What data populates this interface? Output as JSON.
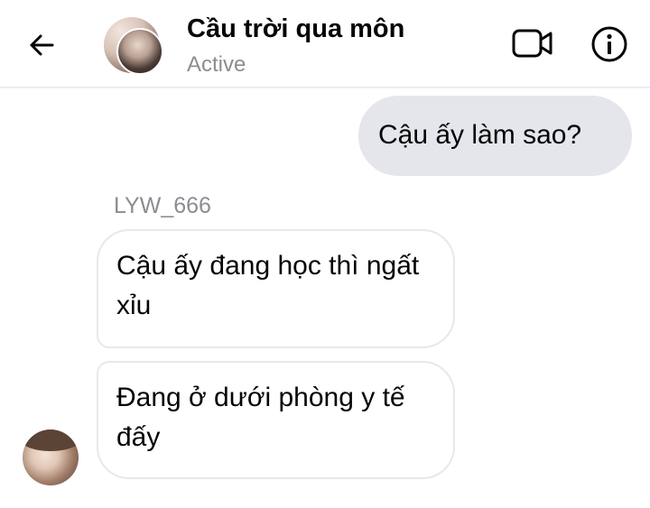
{
  "header": {
    "contact_name": "Cầu trời qua môn",
    "status": "Active",
    "icons": {
      "back": "back-arrow-icon",
      "video": "video-call-icon",
      "info": "info-icon"
    }
  },
  "messages": [
    {
      "direction": "outgoing",
      "text": "Cậu ấy làm sao?"
    },
    {
      "direction": "incoming",
      "sender": "LYW_666",
      "text": "Cậu ấy đang học thì ngất xỉu"
    },
    {
      "direction": "incoming",
      "sender": "LYW_666",
      "text": "Đang ở dưới phòng y tế đấy"
    }
  ],
  "colors": {
    "outgoing_bubble": "#e4e6eb",
    "incoming_border": "#e7e8ec",
    "text": "#050505",
    "muted": "#8a8d91"
  }
}
